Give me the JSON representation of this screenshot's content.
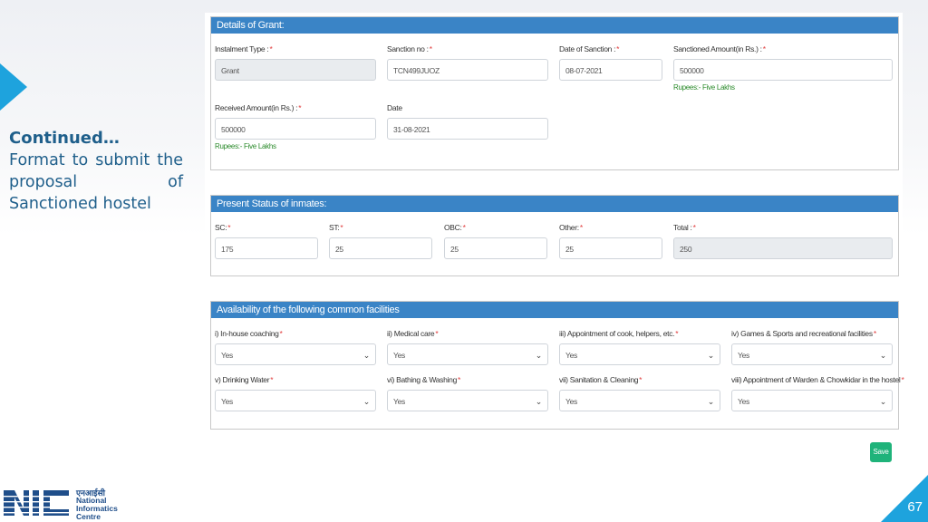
{
  "side": {
    "title": "Continued…",
    "body": "Format to submit the proposal of Sanctioned hostel"
  },
  "grant": {
    "header": "Details of Grant:",
    "installment_type": {
      "label": "Instalment Type :",
      "value": "Grant"
    },
    "sanction_no": {
      "label": "Sanction no :",
      "value": "TCN499JUOZ"
    },
    "date_of_sanction": {
      "label": "Date of Sanction :",
      "value": "08-07-2021"
    },
    "sanctioned_amount": {
      "label": "Sanctioned Amount(in Rs.) :",
      "value": "500000",
      "hint": "Rupees:- Five Lakhs"
    },
    "received_amount": {
      "label": "Received Amount(in Rs.) :",
      "value": "500000",
      "hint": "Rupees:- Five Lakhs"
    },
    "date": {
      "label": "Date",
      "value": "31-08-2021"
    }
  },
  "inmates": {
    "header": "Present Status of inmates:",
    "sc": {
      "label": "SC:",
      "value": "175"
    },
    "st": {
      "label": "ST:",
      "value": "25"
    },
    "obc": {
      "label": "OBC:",
      "value": "25"
    },
    "other": {
      "label": "Other:",
      "value": "25"
    },
    "total": {
      "label": "Total :",
      "value": "250"
    }
  },
  "facilities": {
    "header": "Availability of the following common facilities",
    "items": [
      {
        "label": "i) In-house coaching",
        "value": "Yes"
      },
      {
        "label": "ii) Medical care",
        "value": "Yes"
      },
      {
        "label": "iii) Appointment of cook, helpers, etc.",
        "value": "Yes"
      },
      {
        "label": "iv) Games & Sports and recreational facilities",
        "value": "Yes"
      },
      {
        "label": "v) Drinking Water",
        "value": "Yes"
      },
      {
        "label": "vi) Bathing & Washing",
        "value": "Yes"
      },
      {
        "label": "vii) Sanitation & Cleaning",
        "value": "Yes"
      },
      {
        "label": "viii) Appointment of Warden & Chowkidar in the hostel",
        "value": "Yes"
      }
    ]
  },
  "save_label": "Save",
  "logo": {
    "hindi": "एनआईसी",
    "line1": "National",
    "line2": "Informatics",
    "line3": "Centre"
  },
  "page_number": "67",
  "colors": {
    "accent": "#1ea3dd",
    "panel_header": "#3a84c6",
    "save": "#1fb37a",
    "required": "#e03a3a",
    "hint": "#2a8a2a"
  }
}
